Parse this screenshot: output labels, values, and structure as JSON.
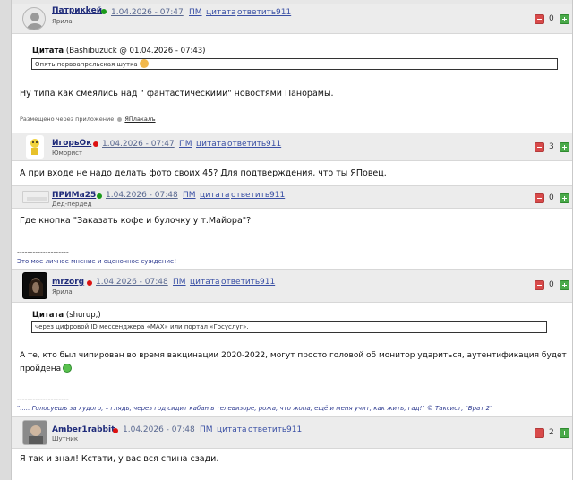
{
  "posts": [
    {
      "user": "Патрикkей",
      "status": "online",
      "rank": "Ярила",
      "date": "1.04.2026 - 07:47",
      "pm": "ПМ",
      "quote": "цитата",
      "reply": "ответить",
      "num": "911",
      "score": "0",
      "quote_title": "Цитата",
      "quote_meta": "(Bashibuzuck @ 01.04.2026 - 07:43)",
      "quote_text": "Опять первоапрельская шутка",
      "text": "Ну типа как смеялись над \" фантастическими\" новостями Панорамы.",
      "footer_prefix": "Размещено через приложение",
      "footer_app": "ЯПлакалъ"
    },
    {
      "user": "ИгорьОк",
      "status": "offline",
      "rank": "Юморист",
      "date": "1.04.2026 - 07:47",
      "pm": "ПМ",
      "quote": "цитата",
      "reply": "ответить",
      "num": "911",
      "score": "3",
      "text": "А при входе не надо делать фото своих 45? Для подтверждения, что ты ЯПовец."
    },
    {
      "user": "ПРИМа25",
      "status": "online",
      "rank": "Дед-пердед",
      "date": "1.04.2026 - 07:48",
      "pm": "ПМ",
      "quote": "цитата",
      "reply": "ответить",
      "num": "911",
      "score": "0",
      "text": "Где кнопка \"Заказать кофе и булочку у т.Майора\"?",
      "separator": "--------------------",
      "signature": "Это мое личное мнение и оценочное суждение!"
    },
    {
      "user": "mrzorg",
      "status": "offline",
      "rank": "Ярила",
      "date": "1.04.2026 - 07:48",
      "pm": "ПМ",
      "quote": "цитата",
      "reply": "ответить",
      "num": "911",
      "score": "0",
      "quote_title": "Цитата",
      "quote_meta": "(shurup,)",
      "quote_text": "через цифровой ID мессенджера «MAX» или портал «Госуслуг».",
      "text_line1": "А те, кто был чипирован во время вакцинации 2020-2022, могут просто головой об монитор удариться, аутентификация будет",
      "text_line2": "пройдена",
      "separator": "--------------------",
      "signature": "\"..... Голосуешь за худого, – глядь, через год сидит кабан в телевизоре, рожа, что жопа, ещё и меня учит, как жить, гад!\" © Таксист, \"Брат 2\""
    },
    {
      "user": "Amber1rabbit",
      "status": "offline",
      "rank": "Шутник",
      "date": "1.04.2026 - 07:48",
      "pm": "ПМ",
      "quote": "цитата",
      "reply": "ответить",
      "num": "911",
      "score": "2",
      "text": "Я так и знал! Кстати, у вас вся спина сзади."
    }
  ],
  "colors": {
    "header_bg": "#ececec",
    "link": "#3a50a5",
    "minus": "#d84a4a",
    "plus": "#4aa94a"
  }
}
